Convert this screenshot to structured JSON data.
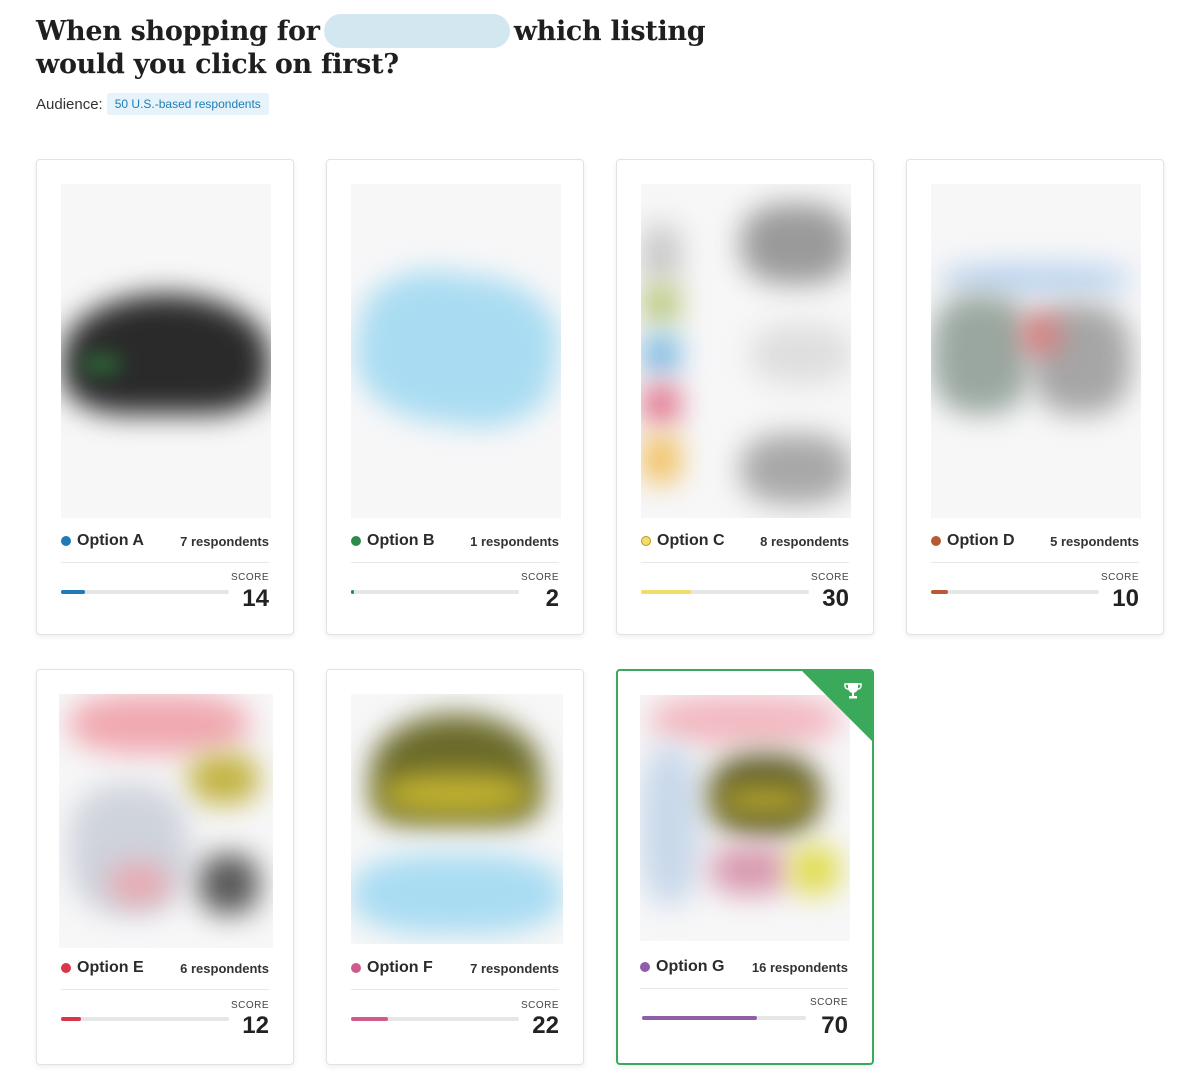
{
  "title": {
    "before": "When shopping for",
    "after": "which listing would you click on first?"
  },
  "audience": {
    "label": "Audience:",
    "tag": "50 U.S.-based respondents"
  },
  "score_label": "SCORE",
  "options": [
    {
      "name": "Option A",
      "respondents": "7 respondents",
      "score": "14",
      "score_value": 14,
      "color": "#1f7ab5"
    },
    {
      "name": "Option B",
      "respondents": "1 respondents",
      "score": "2",
      "score_value": 2,
      "color": "#2c8a4a"
    },
    {
      "name": "Option C",
      "respondents": "8 respondents",
      "score": "30",
      "score_value": 30,
      "color": "#f5dc6a"
    },
    {
      "name": "Option D",
      "respondents": "5 respondents",
      "score": "10",
      "score_value": 10,
      "color": "#b65a33"
    },
    {
      "name": "Option E",
      "respondents": "6 respondents",
      "score": "12",
      "score_value": 12,
      "color": "#d9364a"
    },
    {
      "name": "Option F",
      "respondents": "7 respondents",
      "score": "22",
      "score_value": 22,
      "color": "#cf5a8c"
    },
    {
      "name": "Option G",
      "respondents": "16 respondents",
      "score": "70",
      "score_value": 70,
      "color": "#8e5ea8",
      "winner": true
    }
  ],
  "winner_icon": "trophy-icon"
}
